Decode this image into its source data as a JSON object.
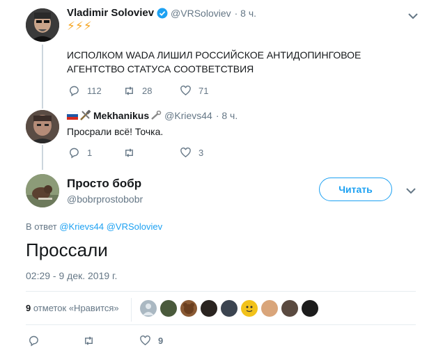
{
  "tweet1": {
    "name": "Vladimir Soloviev",
    "handle": "@VRSoloviev",
    "time": "· 8 ч.",
    "emoji": "⚡⚡⚡",
    "text": "ИСПОЛКОМ WADA ЛИШИЛ РОССИЙСКОЕ АНТИДОПИНГОВОЕ АГЕНТСТВО СТАТУСА СООТВЕТСТВИЯ",
    "replies": "112",
    "retweets": "28",
    "likes": "71"
  },
  "tweet2": {
    "name": "Mekhanikus",
    "handle": "@Krievs44",
    "time": "· 8 ч.",
    "text": "Просрали всё! Точка.",
    "replies": "1",
    "retweets": "",
    "likes": "3"
  },
  "main": {
    "name": "Просто бобр",
    "handle": "@bobrprostobobr",
    "follow_label": "Читать",
    "reply_prefix": "В ответ",
    "reply_to_1": "@Krievs44",
    "reply_to_2": "@VRSoloviev",
    "text": "Проссали",
    "timestamp": "02:29 - 9 дек. 2019 г.",
    "likes_count": "9",
    "likes_label": "отметок «Нравится»",
    "bottom_likes": "9"
  },
  "colors": {
    "accent": "#1da1f2",
    "muted": "#657786",
    "verified": "#1da1f2"
  }
}
